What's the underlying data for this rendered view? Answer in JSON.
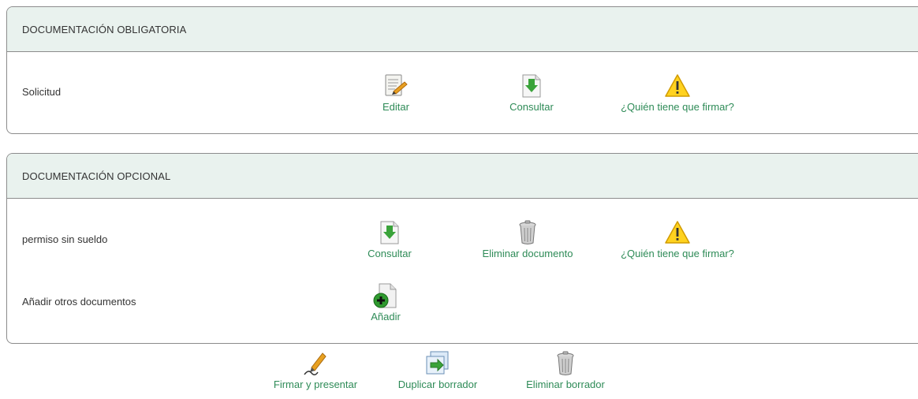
{
  "panel_mandatory": {
    "title": "DOCUMENTACIÓN OBLIGATORIA",
    "rows": [
      {
        "label": "Solicitud",
        "actions": {
          "edit": "Editar",
          "consult": "Consultar",
          "who_signs": "¿Quién tiene que firmar?"
        }
      }
    ]
  },
  "panel_optional": {
    "title": "DOCUMENTACIÓN OPCIONAL",
    "rows": [
      {
        "label": "permiso sin sueldo",
        "actions": {
          "consult": "Consultar",
          "delete": "Eliminar documento",
          "who_signs": "¿Quién tiene que firmar?"
        }
      },
      {
        "label": "Añadir otros documentos",
        "actions": {
          "add": "Añadir"
        }
      }
    ]
  },
  "bottom_actions": {
    "sign": "Firmar y presentar",
    "duplicate": "Duplicar borrador",
    "delete_draft": "Eliminar borrador"
  },
  "colors": {
    "link": "#2e8b57",
    "header_bg": "#e9f2ee",
    "border": "#8c8c8c"
  }
}
